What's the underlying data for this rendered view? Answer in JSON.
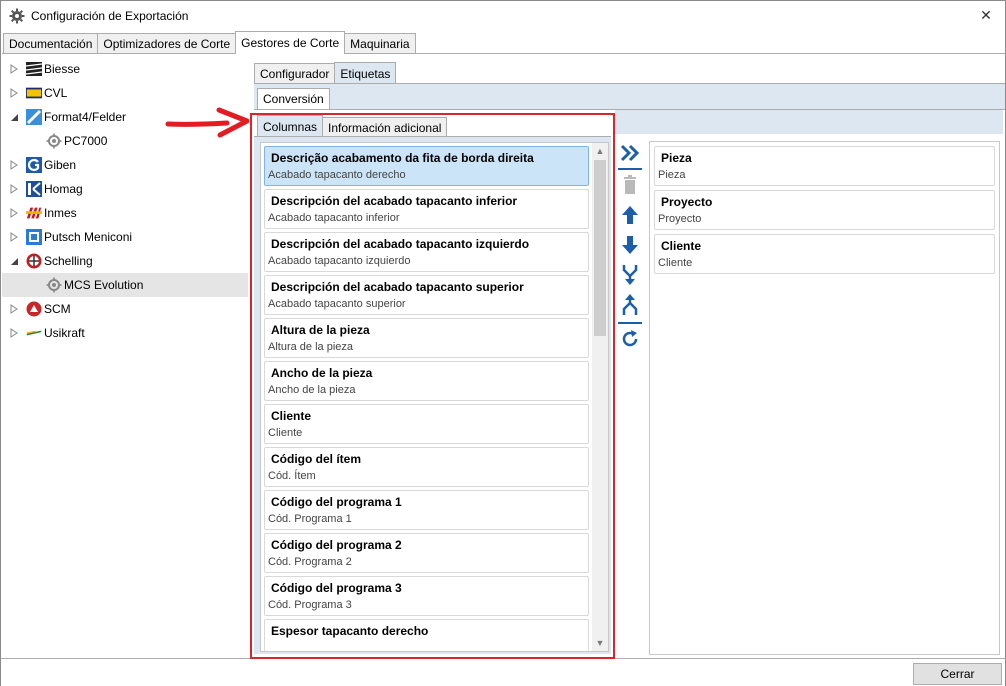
{
  "window": {
    "title": "Configuración de Exportación",
    "close_label": "✕"
  },
  "main_tabs": [
    "Documentación",
    "Optimizadores de Corte",
    "Gestores de Corte",
    "Maquinaria"
  ],
  "tree": [
    {
      "label": "Biesse",
      "icon": "biesse-icon",
      "expander": "collapsed"
    },
    {
      "label": "CVL",
      "icon": "cvl-icon",
      "expander": "collapsed"
    },
    {
      "label": "Format4/Felder",
      "icon": "format4-icon",
      "expander": "expanded"
    },
    {
      "label": "PC7000",
      "icon": "gear-icon",
      "expander": "none",
      "child": true
    },
    {
      "label": "Giben",
      "icon": "giben-icon",
      "expander": "collapsed"
    },
    {
      "label": "Homag",
      "icon": "homag-icon",
      "expander": "collapsed"
    },
    {
      "label": "Inmes",
      "icon": "inmes-icon",
      "expander": "collapsed"
    },
    {
      "label": "Putsch Meniconi",
      "icon": "putsch-icon",
      "expander": "collapsed"
    },
    {
      "label": "Schelling",
      "icon": "schelling-icon",
      "expander": "expanded"
    },
    {
      "label": "MCS Evolution",
      "icon": "gear-icon",
      "expander": "none",
      "child": true,
      "selected": true
    },
    {
      "label": "SCM",
      "icon": "scm-icon",
      "expander": "collapsed"
    },
    {
      "label": "Usikraft",
      "icon": "usikraft-icon",
      "expander": "collapsed"
    }
  ],
  "sub_tabs": [
    "Configurador",
    "Etiquetas"
  ],
  "conversion_tab": "Conversión",
  "column_tabs": [
    "Columnas",
    "Información adicional"
  ],
  "available_columns": [
    {
      "name": "Descrição acabamento da fita de borda direita",
      "code": "Acabado tapacanto derecho",
      "selected": true
    },
    {
      "name": "Descripción del acabado tapacanto inferior",
      "code": "Acabado tapacanto inferior"
    },
    {
      "name": "Descripción del acabado tapacanto izquierdo",
      "code": "Acabado tapacanto izquierdo"
    },
    {
      "name": "Descripción del acabado tapacanto superior",
      "code": "Acabado tapacanto superior"
    },
    {
      "name": "Altura de la pieza",
      "code": "Altura de la pieza"
    },
    {
      "name": "Ancho de la pieza",
      "code": "Ancho de la pieza"
    },
    {
      "name": "Cliente",
      "code": "Cliente"
    },
    {
      "name": "Código del ítem",
      "code": "Cód. Ítem"
    },
    {
      "name": "Código del programa 1",
      "code": "Cód. Programa 1"
    },
    {
      "name": "Código del programa 2",
      "code": "Cód. Programa 2"
    },
    {
      "name": "Código del programa 3",
      "code": "Cód. Programa 3"
    },
    {
      "name": "Espesor tapacanto derecho",
      "code": ""
    }
  ],
  "selected_columns": [
    {
      "name": "Pieza",
      "code": "Pieza"
    },
    {
      "name": "Proyecto",
      "code": "Proyecto"
    },
    {
      "name": "Cliente",
      "code": "Cliente"
    }
  ],
  "buttons": [
    "add-all-icon",
    "delete-icon",
    "move-up-icon",
    "move-down-icon",
    "merge-icon",
    "split-icon",
    "refresh-icon"
  ],
  "footer": {
    "close_label": "Cerrar"
  },
  "colors": {
    "accent": "#1c5fa8",
    "highlight": "#d9252c",
    "panel": "#dde7f2",
    "selection": "#cce4f7"
  }
}
